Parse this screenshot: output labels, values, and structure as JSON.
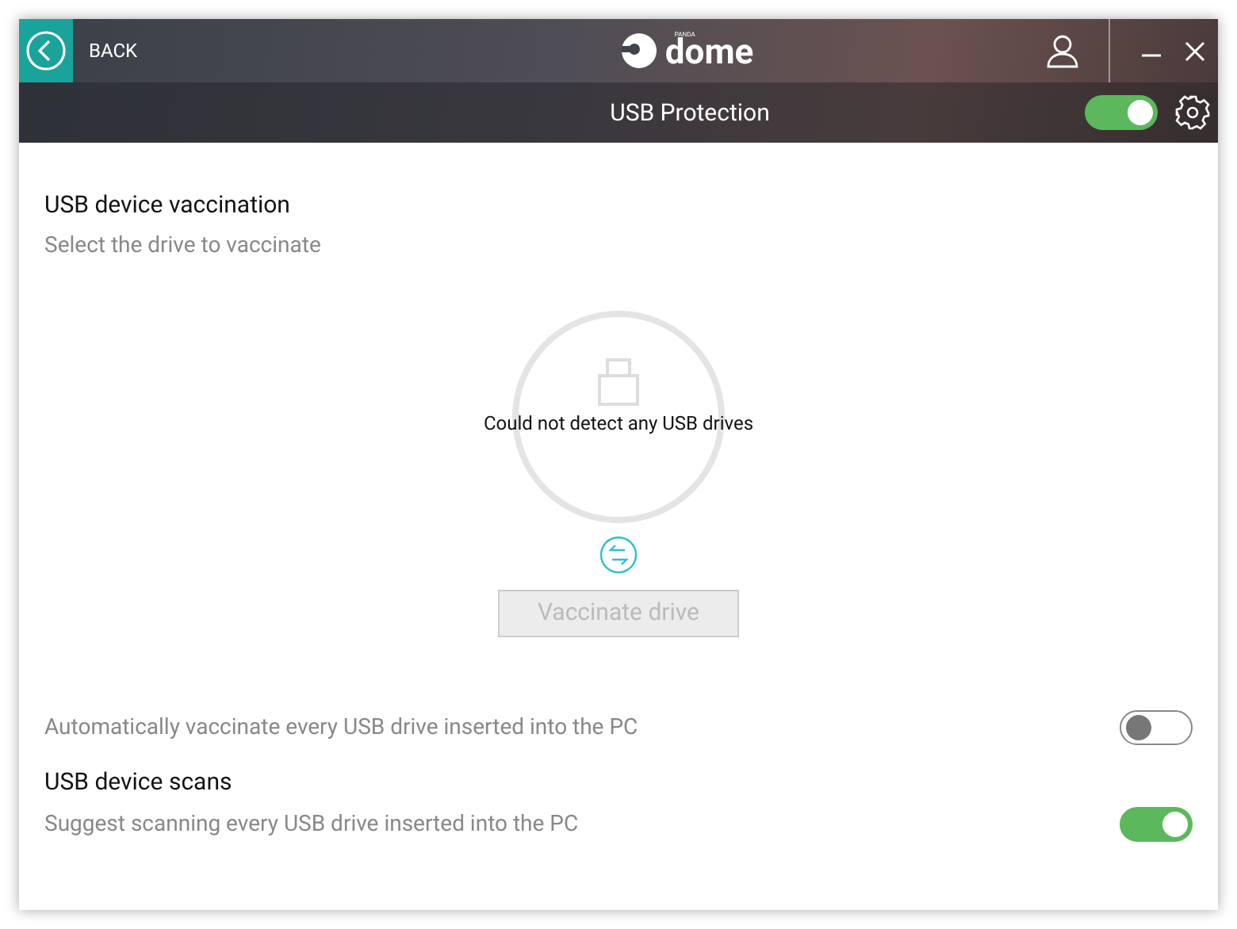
{
  "header": {
    "back": "BACK",
    "logo_small": "PANDA",
    "logo": "dome"
  },
  "subbar": {
    "title": "USB Protection",
    "on": true
  },
  "vaccination": {
    "title": "USB device vaccination",
    "subtitle": "Select the drive to vaccinate",
    "empty_message": "Could not detect any USB drives",
    "button": {
      "label": "Vaccinate drive",
      "disabled": true
    }
  },
  "settings": [
    {
      "kind": "toggle",
      "description": "Automatically vaccinate every USB drive inserted into the PC",
      "on": false
    },
    {
      "kind": "toggle",
      "title": "USB device scans",
      "description": "Suggest scanning every USB drive inserted into the PC",
      "on": true
    }
  ]
}
